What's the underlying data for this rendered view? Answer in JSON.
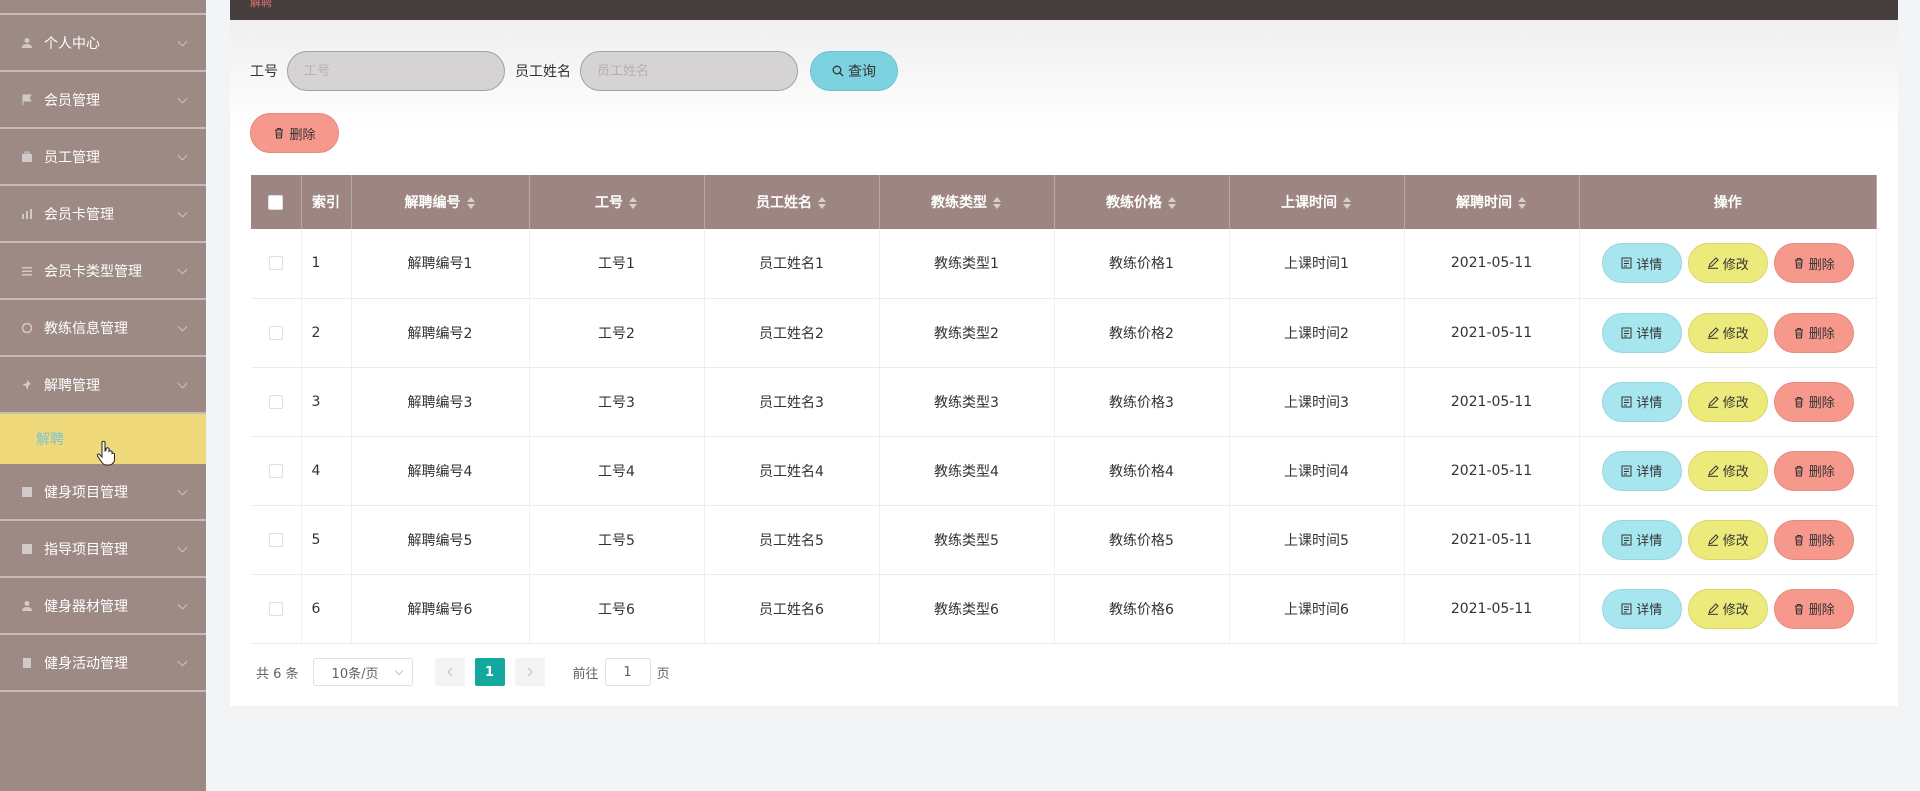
{
  "topbar": {
    "breadcrumb": "解聘"
  },
  "sidebar": {
    "items": [
      {
        "label": "个人中心",
        "icon": "user-icon"
      },
      {
        "label": "会员管理",
        "icon": "flag-icon"
      },
      {
        "label": "员工管理",
        "icon": "briefcase-icon"
      },
      {
        "label": "会员卡管理",
        "icon": "chart-icon"
      },
      {
        "label": "会员卡类型管理",
        "icon": "list-icon"
      },
      {
        "label": "教练信息管理",
        "icon": "circle-icon"
      },
      {
        "label": "解聘管理",
        "icon": "pin-icon"
      }
    ],
    "active_sub": "解聘",
    "items_after": [
      {
        "label": "健身项目管理",
        "icon": "grid-icon"
      },
      {
        "label": "指导项目管理",
        "icon": "grid-icon"
      },
      {
        "label": "健身器材管理",
        "icon": "user-icon"
      },
      {
        "label": "健身活动管理",
        "icon": "doc-icon"
      }
    ]
  },
  "search": {
    "emp_no_label": "工号",
    "emp_no_placeholder": "工号",
    "emp_name_label": "员工姓名",
    "emp_name_placeholder": "员工姓名",
    "query_label": "查询"
  },
  "toolbar": {
    "delete_label": "删除"
  },
  "table": {
    "columns": [
      "索引",
      "解聘编号",
      "工号",
      "员工姓名",
      "教练类型",
      "教练价格",
      "上课时间",
      "解聘时间",
      "操作"
    ],
    "rows": [
      {
        "index": "1",
        "dismiss_no": "解聘编号1",
        "emp_no": "工号1",
        "emp_name": "员工姓名1",
        "coach_type": "教练类型1",
        "coach_price": "教练价格1",
        "class_time": "上课时间1",
        "dismiss_time": "2021-05-11"
      },
      {
        "index": "2",
        "dismiss_no": "解聘编号2",
        "emp_no": "工号2",
        "emp_name": "员工姓名2",
        "coach_type": "教练类型2",
        "coach_price": "教练价格2",
        "class_time": "上课时间2",
        "dismiss_time": "2021-05-11"
      },
      {
        "index": "3",
        "dismiss_no": "解聘编号3",
        "emp_no": "工号3",
        "emp_name": "员工姓名3",
        "coach_type": "教练类型3",
        "coach_price": "教练价格3",
        "class_time": "上课时间3",
        "dismiss_time": "2021-05-11"
      },
      {
        "index": "4",
        "dismiss_no": "解聘编号4",
        "emp_no": "工号4",
        "emp_name": "员工姓名4",
        "coach_type": "教练类型4",
        "coach_price": "教练价格4",
        "class_time": "上课时间4",
        "dismiss_time": "2021-05-11"
      },
      {
        "index": "5",
        "dismiss_no": "解聘编号5",
        "emp_no": "工号5",
        "emp_name": "员工姓名5",
        "coach_type": "教练类型5",
        "coach_price": "教练价格5",
        "class_time": "上课时间5",
        "dismiss_time": "2021-05-11"
      },
      {
        "index": "6",
        "dismiss_no": "解聘编号6",
        "emp_no": "工号6",
        "emp_name": "员工姓名6",
        "coach_type": "教练类型6",
        "coach_price": "教练价格6",
        "class_time": "上课时间6",
        "dismiss_time": "2021-05-11"
      }
    ],
    "actions": {
      "detail": "详情",
      "edit": "修改",
      "delete": "删除"
    }
  },
  "pagination": {
    "total": "共 6 条",
    "page_size": "10条/页",
    "current_page": "1",
    "goto_prefix": "前往",
    "goto_value": "1",
    "goto_suffix": "页"
  },
  "colors": {
    "sidebar_bg": "#9d8a85",
    "submenu_active": "#f0d97a",
    "table_header": "#9d8682",
    "detail_btn": "#a7e6ef",
    "edit_btn": "#ecea7b",
    "delete_btn": "#f6988c",
    "pager_active": "#13a89e"
  }
}
